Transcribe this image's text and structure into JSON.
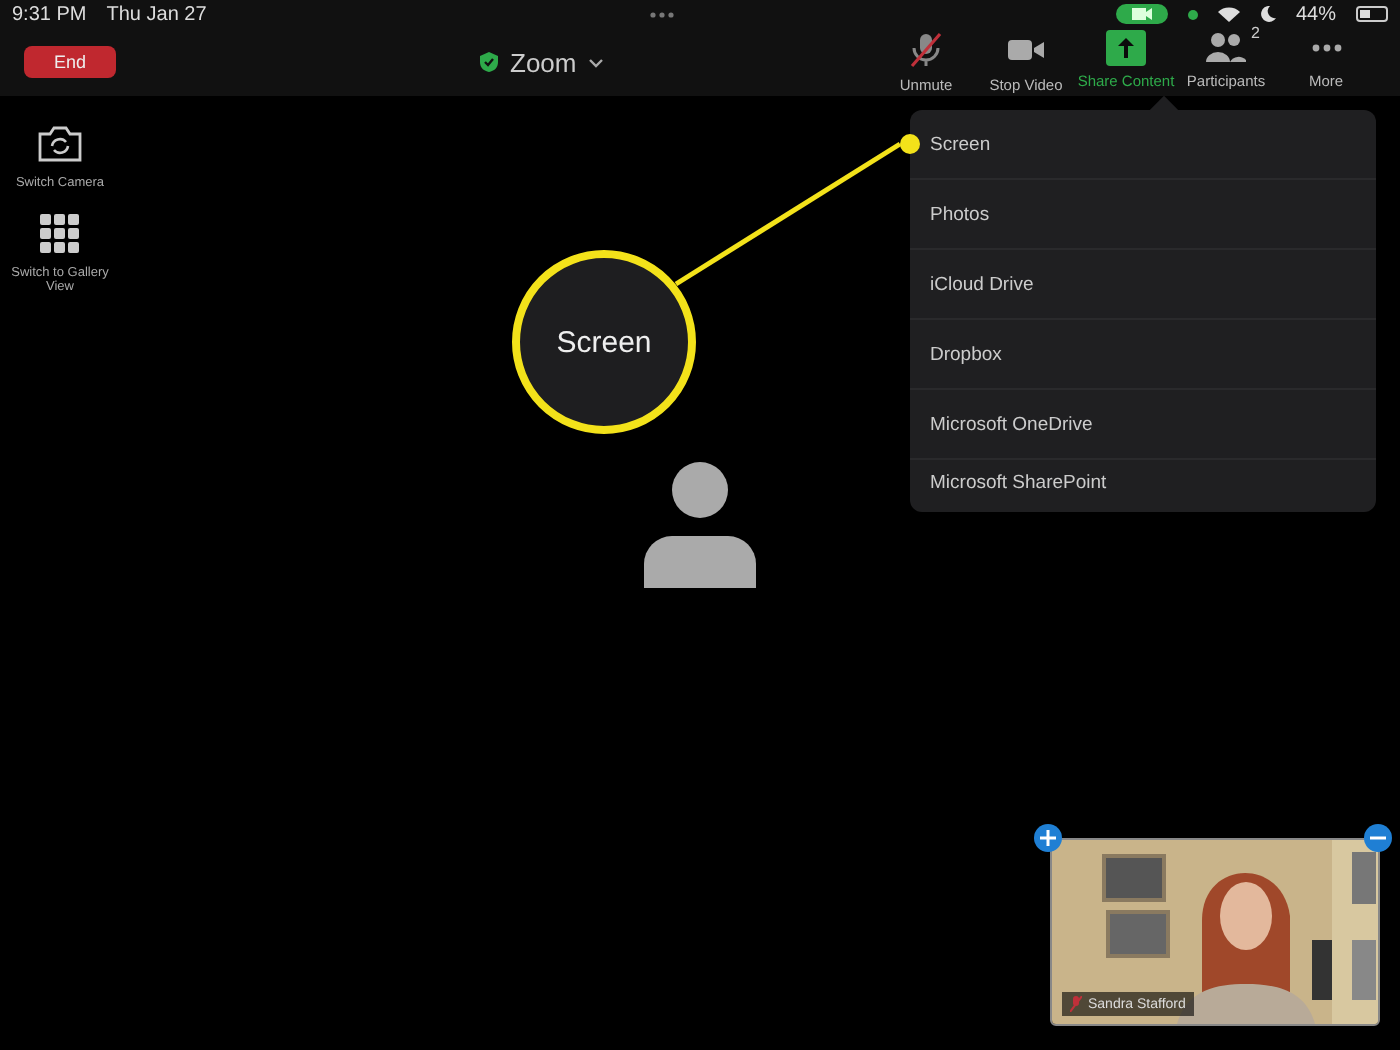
{
  "status_bar": {
    "time": "9:31 PM",
    "date": "Thu Jan 27",
    "battery": "44%"
  },
  "end_button": "End",
  "meeting_title": "Zoom",
  "toolbar": [
    {
      "label": "Unmute",
      "kind": "mic-muted",
      "selected": false
    },
    {
      "label": "Stop Video",
      "kind": "camera",
      "selected": false
    },
    {
      "label": "Share Content",
      "kind": "share",
      "selected": true
    },
    {
      "label": "Participants",
      "kind": "participants",
      "selected": false,
      "badge": "2"
    },
    {
      "label": "More",
      "kind": "more",
      "selected": false
    }
  ],
  "side_buttons": [
    {
      "label": "Switch Camera",
      "kind": "camera-switch"
    },
    {
      "label": "Switch to Gallery View",
      "kind": "grid"
    }
  ],
  "share_menu": [
    {
      "label": "Screen",
      "selected": true
    },
    {
      "label": "Photos",
      "selected": false
    },
    {
      "label": "iCloud Drive",
      "selected": false
    },
    {
      "label": "Dropbox",
      "selected": false
    },
    {
      "label": "Microsoft OneDrive",
      "selected": false
    },
    {
      "label": "Microsoft SharePoint",
      "selected": false
    }
  ],
  "callout": {
    "text": "Screen"
  },
  "self_view": {
    "name": "Sandra Stafford",
    "muted": true
  }
}
